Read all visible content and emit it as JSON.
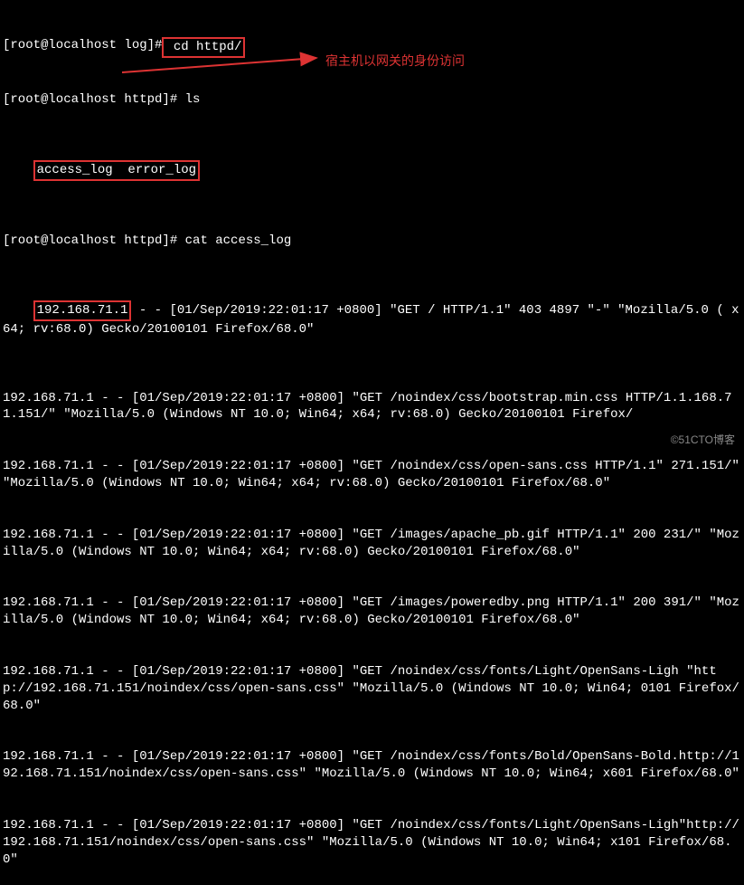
{
  "prompts": {
    "log": "[root@localhost log]#",
    "httpd": "[root@localhost httpd]#"
  },
  "commands": {
    "cd": " cd httpd/",
    "ls": " ls",
    "cat": " cat access_log"
  },
  "ls_output": "access_log  error_log",
  "annotation": "宿主机以网关的身份访问",
  "highlighted_ip": "192.168.71.1",
  "log_lines": [
    " - - [01/Sep/2019:22:01:17 +0800] \"GET / HTTP/1.1\" 403 4897 \"-\" \"Mozilla/5.0 ( x64; rv:68.0) Gecko/20100101 Firefox/68.0\"",
    "192.168.71.1 - - [01/Sep/2019:22:01:17 +0800] \"GET /noindex/css/bootstrap.min.css HTTP/1.1.168.71.151/\" \"Mozilla/5.0 (Windows NT 10.0; Win64; x64; rv:68.0) Gecko/20100101 Firefox/",
    "192.168.71.1 - - [01/Sep/2019:22:01:17 +0800] \"GET /noindex/css/open-sans.css HTTP/1.1\" 271.151/\" \"Mozilla/5.0 (Windows NT 10.0; Win64; x64; rv:68.0) Gecko/20100101 Firefox/68.0\"",
    "192.168.71.1 - - [01/Sep/2019:22:01:17 +0800] \"GET /images/apache_pb.gif HTTP/1.1\" 200 231/\" \"Mozilla/5.0 (Windows NT 10.0; Win64; x64; rv:68.0) Gecko/20100101 Firefox/68.0\"",
    "192.168.71.1 - - [01/Sep/2019:22:01:17 +0800] \"GET /images/poweredby.png HTTP/1.1\" 200 391/\" \"Mozilla/5.0 (Windows NT 10.0; Win64; x64; rv:68.0) Gecko/20100101 Firefox/68.0\"",
    "192.168.71.1 - - [01/Sep/2019:22:01:17 +0800] \"GET /noindex/css/fonts/Light/OpenSans-Ligh \"http://192.168.71.151/noindex/css/open-sans.css\" \"Mozilla/5.0 (Windows NT 10.0; Win64; 0101 Firefox/68.0\"",
    "192.168.71.1 - - [01/Sep/2019:22:01:17 +0800] \"GET /noindex/css/fonts/Bold/OpenSans-Bold.http://192.168.71.151/noindex/css/open-sans.css\" \"Mozilla/5.0 (Windows NT 10.0; Win64; x601 Firefox/68.0\"",
    "192.168.71.1 - - [01/Sep/2019:22:01:17 +0800] \"GET /noindex/css/fonts/Light/OpenSans-Ligh\"http://192.168.71.151/noindex/css/open-sans.css\" \"Mozilla/5.0 (Windows NT 10.0; Win64; x101 Firefox/68.0\""
  ],
  "watermark": "©51CTO博客"
}
